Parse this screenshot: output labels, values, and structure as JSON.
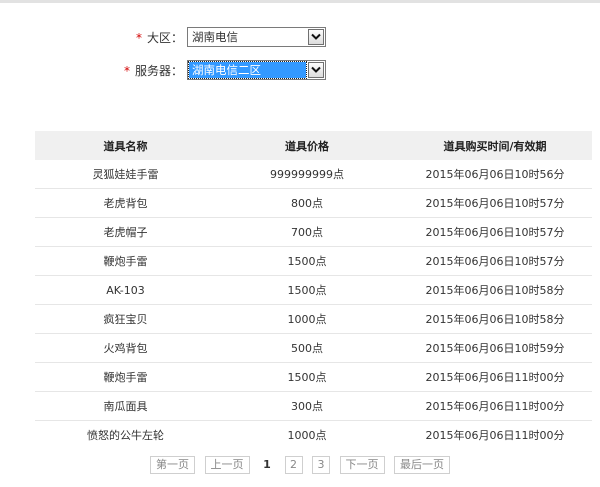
{
  "form": {
    "region": {
      "label": "大区：",
      "value": "湖南电信"
    },
    "server": {
      "label": "服务器：",
      "value": "湖南电信二区"
    }
  },
  "table": {
    "headers": [
      "道具名称",
      "道具价格",
      "道具购买时间/有效期"
    ],
    "rows": [
      {
        "name": "灵狐娃娃手雷",
        "price": "999999999点",
        "time": "2015年06月06日10时56分"
      },
      {
        "name": "老虎背包",
        "price": "800点",
        "time": "2015年06月06日10时57分"
      },
      {
        "name": "老虎帽子",
        "price": "700点",
        "time": "2015年06月06日10时57分"
      },
      {
        "name": "鞭炮手雷",
        "price": "1500点",
        "time": "2015年06月06日10时57分"
      },
      {
        "name": "AK-103",
        "price": "1500点",
        "time": "2015年06月06日10时58分"
      },
      {
        "name": "疯狂宝贝",
        "price": "1000点",
        "time": "2015年06月06日10时58分"
      },
      {
        "name": "火鸡背包",
        "price": "500点",
        "time": "2015年06月06日10时59分"
      },
      {
        "name": "鞭炮手雷",
        "price": "1500点",
        "time": "2015年06月06日11时00分"
      },
      {
        "name": "南瓜面具",
        "price": "300点",
        "time": "2015年06月06日11时00分"
      },
      {
        "name": "愤怒的公牛左轮",
        "price": "1000点",
        "time": "2015年06月06日11时00分"
      }
    ]
  },
  "pager": {
    "first": "第一页",
    "prev": "上一页",
    "current": "1",
    "pages": [
      "2",
      "3"
    ],
    "next": "下一页",
    "last": "最后一页"
  }
}
